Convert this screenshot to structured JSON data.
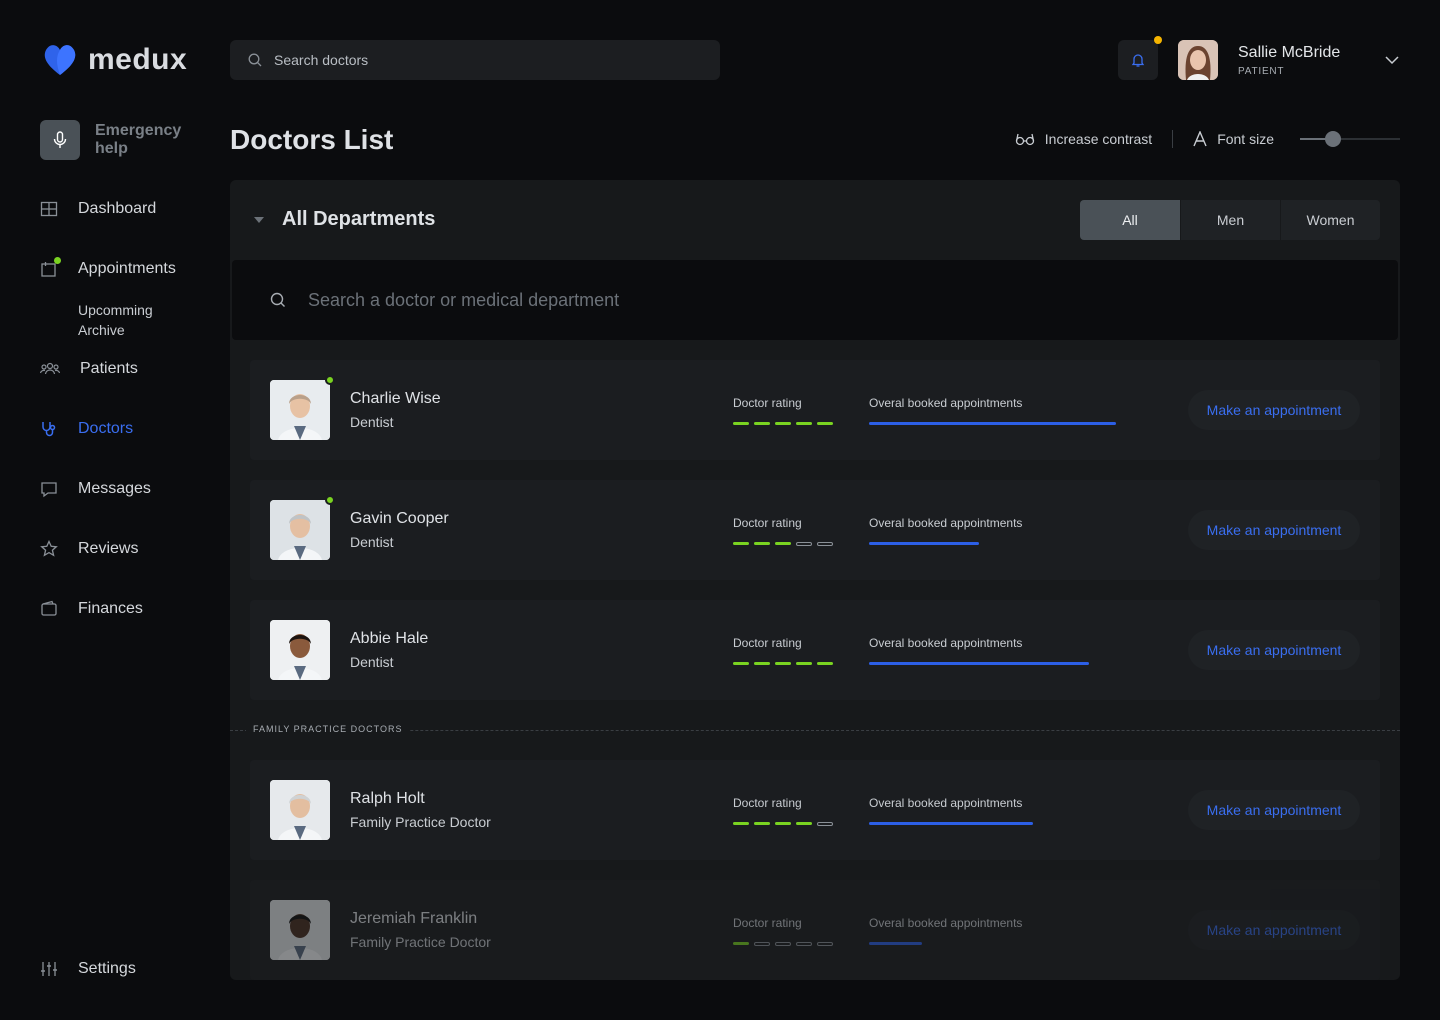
{
  "app": {
    "name": "medux"
  },
  "search": {
    "placeholder": "Search doctors"
  },
  "user": {
    "name": "Sallie McBride",
    "role": "PATIENT"
  },
  "emergency": {
    "label": "Emergency help"
  },
  "nav": {
    "dashboard": "Dashboard",
    "appointments": "Appointments",
    "upcoming": "Upcomming",
    "archive": "Archive",
    "patients": "Patients",
    "doctors": "Doctors",
    "messages": "Messages",
    "reviews": "Reviews",
    "finances": "Finances",
    "settings": "Settings"
  },
  "page": {
    "title": "Doctors List"
  },
  "accessibility": {
    "contrast": "Increase contrast",
    "font_size": "Font size",
    "font_level": 0.3
  },
  "filter": {
    "department": "All Departments",
    "tabs": [
      "All",
      "Men",
      "Women"
    ],
    "active_tab": "All",
    "search_placeholder": "Search a doctor or medical department"
  },
  "labels": {
    "rating": "Doctor rating",
    "appointments": "Overal booked appointments",
    "action": "Make an appointment"
  },
  "group_label": "FAMILY PRACTICE DOCTORS",
  "colors": {
    "accent": "#2c5fe6",
    "rating": "#7ad321",
    "online": "#7ad321",
    "notification": "#f5b400"
  },
  "doctors": [
    {
      "name": "Charlie Wise",
      "specialty": "Dentist",
      "online": true,
      "rating": 5,
      "booked": 0.74
    },
    {
      "name": "Gavin Cooper",
      "specialty": "Dentist",
      "online": true,
      "rating": 3,
      "booked": 0.33
    },
    {
      "name": "Abbie Hale",
      "specialty": "Dentist",
      "online": false,
      "rating": 5,
      "booked": 0.66
    },
    {
      "name": "Ralph Holt",
      "specialty": "Family Practice Doctor",
      "online": false,
      "rating": 4,
      "booked": 0.49
    },
    {
      "name": "Jeremiah Franklin",
      "specialty": "Family Practice Doctor",
      "online": false,
      "rating": 1,
      "booked": 0.16
    }
  ]
}
